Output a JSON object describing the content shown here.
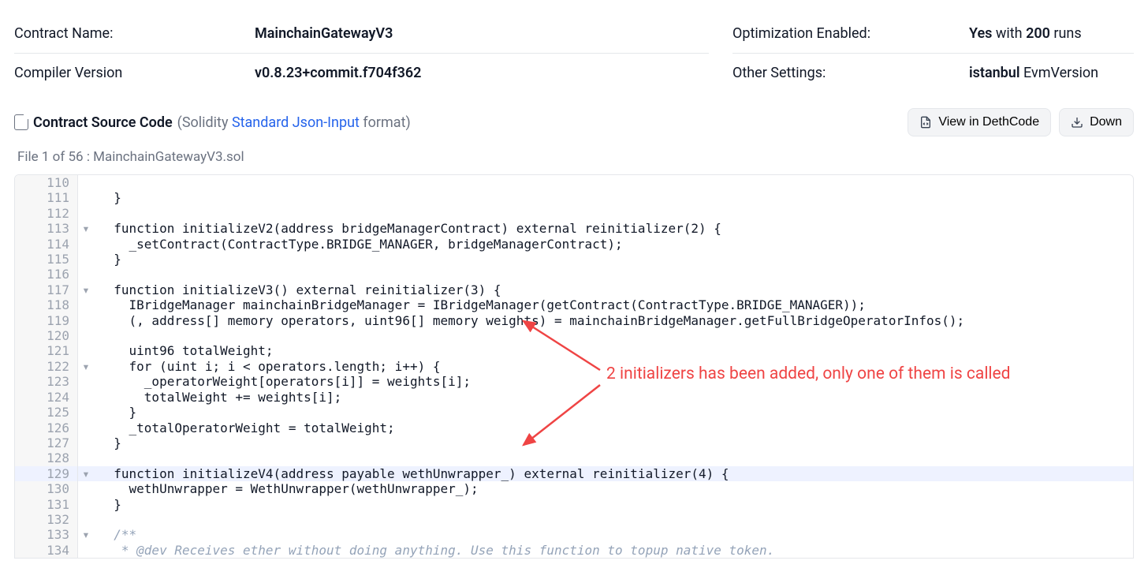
{
  "meta": {
    "contract_name_label": "Contract Name:",
    "contract_name_value": "MainchainGatewayV3",
    "compiler_label": "Compiler Version",
    "compiler_value": "v0.8.23+commit.f704f362",
    "optimization_label": "Optimization Enabled:",
    "optimization_prefix": "Yes",
    "optimization_middle": " with ",
    "optimization_runs": "200",
    "optimization_suffix": " runs",
    "other_label": "Other Settings:",
    "other_bold": "istanbul",
    "other_rest": " EvmVersion"
  },
  "source_header": {
    "title": "Contract Source Code",
    "sub_open": " (Solidity ",
    "link": "Standard Json-Input",
    "sub_close": " format)"
  },
  "buttons": {
    "view_dethcode": "View in DethCode",
    "download": "Down"
  },
  "file_info": {
    "pos": "File 1 of 56 : ",
    "name": "MainchainGatewayV3.sol"
  },
  "code_lines": [
    {
      "n": "110",
      "fold": "",
      "txt": ""
    },
    {
      "n": "111",
      "fold": "",
      "txt": "  }"
    },
    {
      "n": "112",
      "fold": "",
      "txt": ""
    },
    {
      "n": "113",
      "fold": "▾",
      "txt": "  function initializeV2(address bridgeManagerContract) external reinitializer(2) {"
    },
    {
      "n": "114",
      "fold": "",
      "txt": "    _setContract(ContractType.BRIDGE_MANAGER, bridgeManagerContract);"
    },
    {
      "n": "115",
      "fold": "",
      "txt": "  }"
    },
    {
      "n": "116",
      "fold": "",
      "txt": ""
    },
    {
      "n": "117",
      "fold": "▾",
      "txt": "  function initializeV3() external reinitializer(3) {"
    },
    {
      "n": "118",
      "fold": "",
      "txt": "    IBridgeManager mainchainBridgeManager = IBridgeManager(getContract(ContractType.BRIDGE_MANAGER));"
    },
    {
      "n": "119",
      "fold": "",
      "txt": "    (, address[] memory operators, uint96[] memory weights) = mainchainBridgeManager.getFullBridgeOperatorInfos();"
    },
    {
      "n": "120",
      "fold": "",
      "txt": ""
    },
    {
      "n": "121",
      "fold": "",
      "txt": "    uint96 totalWeight;"
    },
    {
      "n": "122",
      "fold": "▾",
      "txt": "    for (uint i; i < operators.length; i++) {"
    },
    {
      "n": "123",
      "fold": "",
      "txt": "      _operatorWeight[operators[i]] = weights[i];"
    },
    {
      "n": "124",
      "fold": "",
      "txt": "      totalWeight += weights[i];"
    },
    {
      "n": "125",
      "fold": "",
      "txt": "    }"
    },
    {
      "n": "126",
      "fold": "",
      "txt": "    _totalOperatorWeight = totalWeight;"
    },
    {
      "n": "127",
      "fold": "",
      "txt": "  }"
    },
    {
      "n": "128",
      "fold": "",
      "txt": ""
    },
    {
      "n": "129",
      "fold": "▾",
      "txt": "  function initializeV4(address payable wethUnwrapper_) external reinitializer(4) {",
      "hl": true
    },
    {
      "n": "130",
      "fold": "",
      "txt": "    wethUnwrapper = WethUnwrapper(wethUnwrapper_);"
    },
    {
      "n": "131",
      "fold": "",
      "txt": "  }"
    },
    {
      "n": "132",
      "fold": "",
      "txt": ""
    },
    {
      "n": "133",
      "fold": "▾",
      "txt": "  /**"
    },
    {
      "n": "134",
      "fold": "",
      "txt": "   * @dev Receives ether without doing anything. Use this function to topup native token."
    }
  ],
  "annotation": {
    "text": "2 initializers has been added, only one of them is called"
  }
}
